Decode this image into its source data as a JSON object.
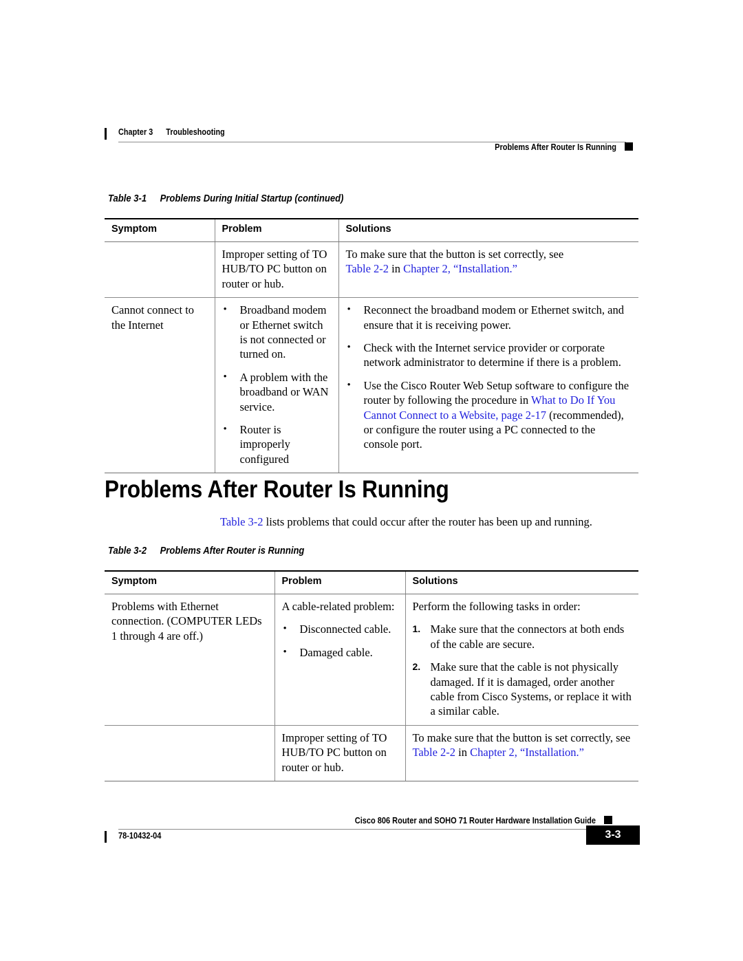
{
  "header": {
    "chapter": "Chapter 3",
    "chapter_title": "Troubleshooting",
    "section_right": "Problems After Router Is Running"
  },
  "table1": {
    "caption_number": "Table 3-1",
    "caption_title": "Problems During Initial Startup (continued)",
    "columns": [
      "Symptom",
      "Problem",
      "Solutions"
    ],
    "rows": [
      {
        "symptom": "",
        "problem_text": "Improper setting of TO HUB/TO PC button on router or hub.",
        "solution_lead": "To make sure that the button is set correctly, see",
        "solution_link1": "Table 2-2",
        "solution_mid": " in ",
        "solution_link2": "Chapter 2, “Installation.”"
      },
      {
        "symptom": "Cannot connect to the Internet",
        "problem_bullets": [
          "Broadband modem or Ethernet switch is not connected or turned on.",
          "A problem with the broadband or WAN service.",
          "Router is improperly configured"
        ],
        "solution_bullets": [
          "Reconnect the broadband modem or Ethernet switch, and ensure that it is receiving power.",
          "Check with the Internet service provider or corporate network administrator to determine if there is a problem."
        ],
        "solution_bullet3_pre": "Use the Cisco Router Web Setup software to configure the router by following the procedure in ",
        "solution_bullet3_link": "What to Do If You Cannot Connect to a Website, page 2-17",
        "solution_bullet3_post": " (recommended), or configure the router using a PC connected to the console port."
      }
    ]
  },
  "section": {
    "heading": "Problems After Router Is Running",
    "intro_link": "Table 3-2",
    "intro_text": " lists problems that could occur after the router has been up and running."
  },
  "table2": {
    "caption_number": "Table 3-2",
    "caption_title": "Problems After Router is Running",
    "columns": [
      "Symptom",
      "Problem",
      "Solutions"
    ],
    "rows": [
      {
        "symptom": "Problems with Ethernet connection. (COMPUTER LEDs 1 through 4 are off.)",
        "problem_lead": "A cable-related problem:",
        "problem_bullets": [
          "Disconnected cable.",
          "Damaged cable."
        ],
        "solution_lead": "Perform the following tasks in order:",
        "solution_steps": [
          {
            "marker": "1.",
            "text": "Make sure that the connectors at both ends of the cable are secure."
          },
          {
            "marker": "2.",
            "text": "Make sure that the cable is not physically damaged. If it is damaged, order another cable from Cisco Systems, or replace it with a similar cable."
          }
        ]
      },
      {
        "symptom": "",
        "problem_text": "Improper setting of TO HUB/TO PC button on router or hub.",
        "solution_pre": "To make sure that the button is set correctly, see ",
        "solution_link1": "Table 2-2",
        "solution_mid": " in ",
        "solution_link2": "Chapter 2, “Installation.”"
      }
    ]
  },
  "footer": {
    "doc_title": "Cisco 806 Router and SOHO 71 Router Hardware Installation Guide",
    "doc_id": "78-10432-04",
    "page_number": "3-3"
  },
  "colors": {
    "link": "#2222dd",
    "rule": "#8a8a8a",
    "text": "#000000"
  }
}
